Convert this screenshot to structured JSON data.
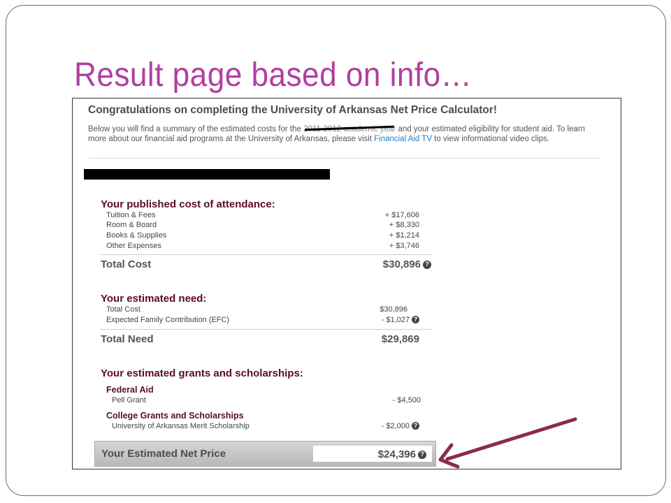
{
  "slide": {
    "title": "Result page based on info…",
    "title_color": "#b13fa0",
    "arrow_color": "#8b2a4f"
  },
  "page": {
    "heading": "Congratulations on completing the University of Arkansas Net Price Calculator!",
    "intro_before_year": "Below you will find a summary of the estimated costs for the",
    "intro_year": "2011-2012 academic year",
    "intro_after_year": "and your estimated eligibility for student aid. To learn more about our financial aid programs at the University of Arkansas, please visit",
    "intro_link": "Financial Aid TV",
    "intro_end": "to view informational video clips.",
    "link_color": "#1c7fc2",
    "heading_color": "#5a0b2a"
  },
  "cost": {
    "title": "Your published cost of attendance:",
    "items": [
      {
        "label": "Tuition & Fees",
        "value": "+ $17,606"
      },
      {
        "label": "Room & Board",
        "value": "+ $8,330"
      },
      {
        "label": "Books & Supplies",
        "value": "+ $1,214"
      },
      {
        "label": "Other Expenses",
        "value": "+ $3,746"
      }
    ],
    "total_label": "Total Cost",
    "total_value": "$30,896"
  },
  "need": {
    "title": "Your estimated need:",
    "items": [
      {
        "label": "Total Cost",
        "value": "$30,896"
      },
      {
        "label": "Expected Family Contribution (EFC)",
        "value": "- $1,027"
      }
    ],
    "total_label": "Total Need",
    "total_value": "$29,869"
  },
  "grants": {
    "title": "Your estimated grants and scholarships:",
    "federal_title": "Federal Aid",
    "federal_items": [
      {
        "label": "Pell Grant",
        "value": "- $4,500"
      }
    ],
    "college_title": "College Grants and Scholarships",
    "college_items": [
      {
        "label": "University of Arkansas Merit Scholarship",
        "value": "- $2,000"
      }
    ]
  },
  "net": {
    "label": "Your Estimated Net Price",
    "value": "$24,396"
  },
  "icons": {
    "help": "?"
  }
}
